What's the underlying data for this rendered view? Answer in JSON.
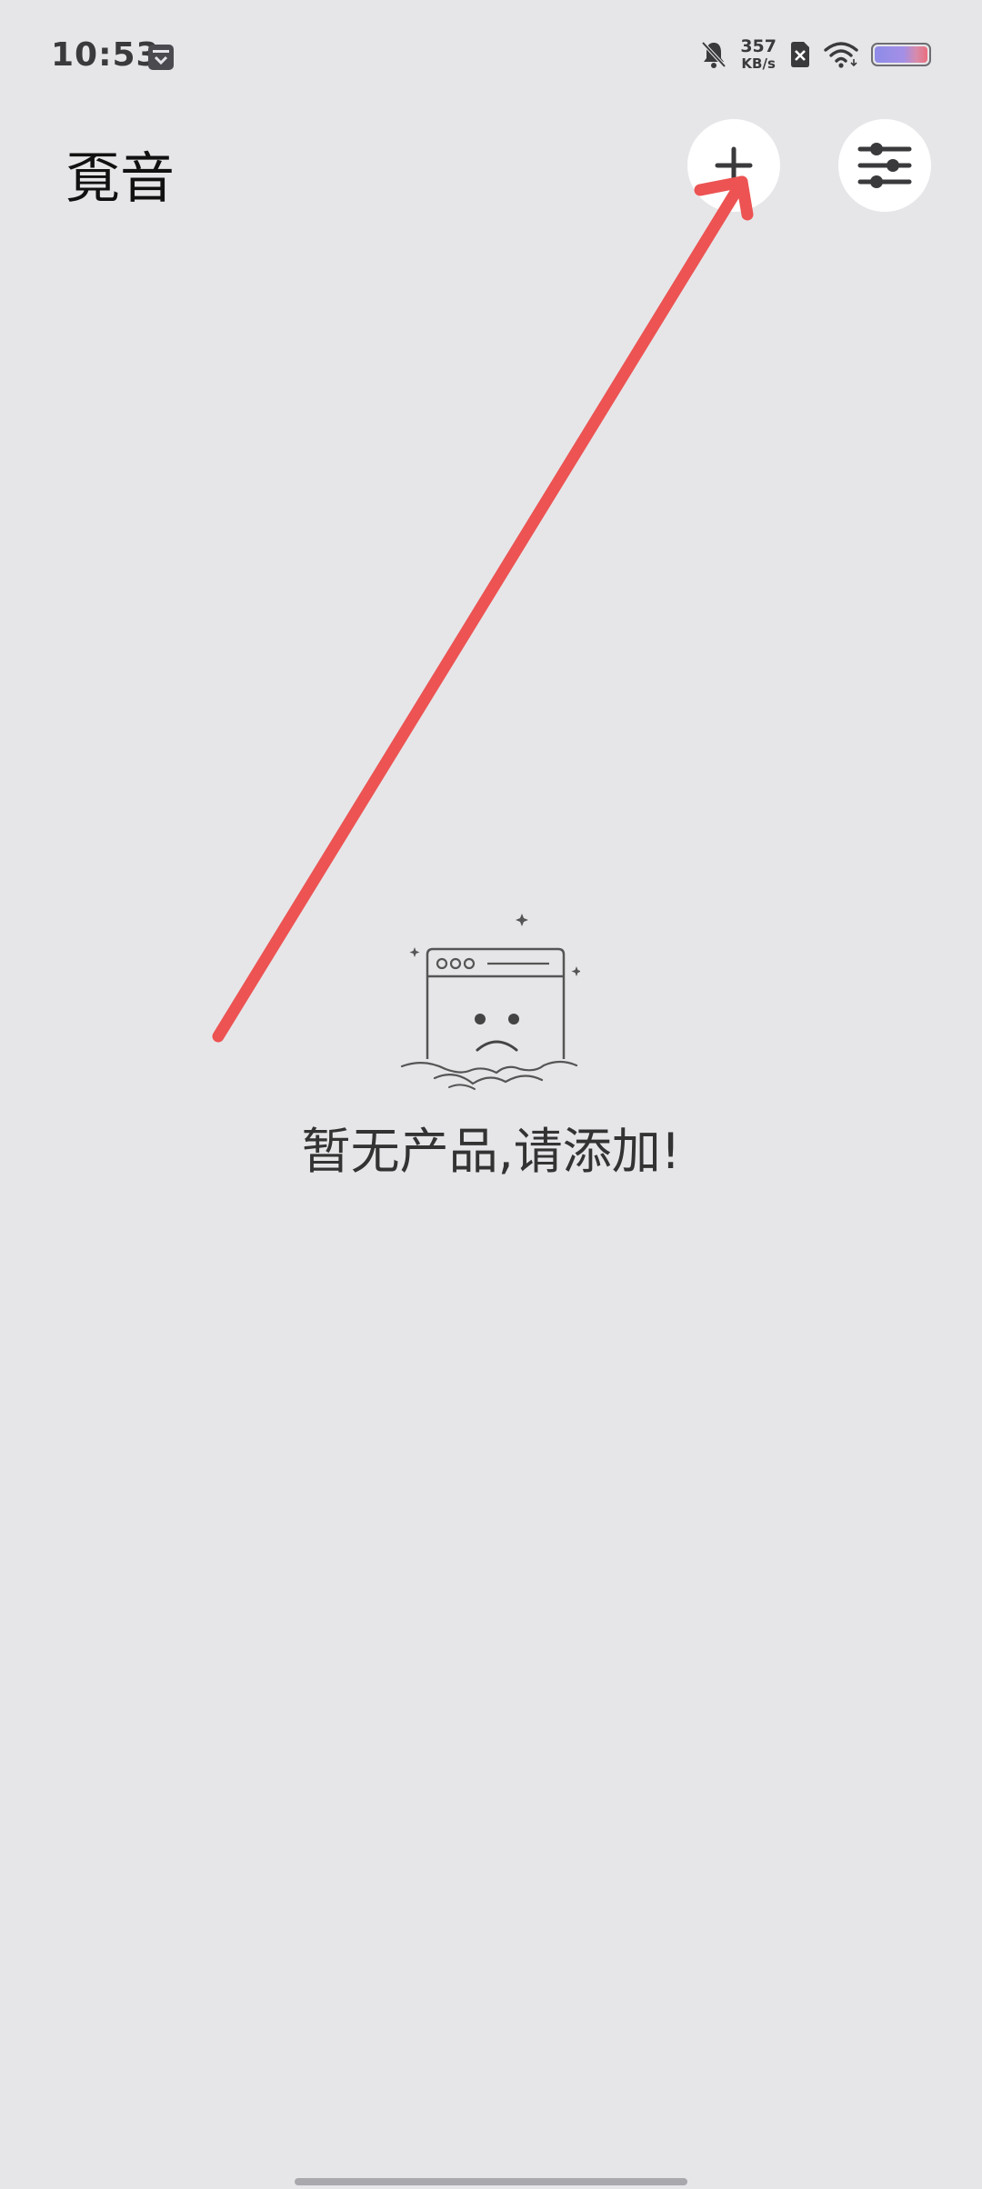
{
  "status_bar": {
    "time": "10:53",
    "net_speed_value": "357",
    "net_speed_unit": "KB/s",
    "icons": [
      "calendar-icon",
      "bell-muted-icon",
      "sim-disabled-icon",
      "wifi-icon",
      "battery-icon"
    ]
  },
  "header": {
    "title": "覔音",
    "add_icon": "plus-icon",
    "settings_icon": "sliders-icon"
  },
  "empty_state": {
    "illustration": "sad-browser-window",
    "message": "暂无产品,请添加!"
  },
  "colors": {
    "background": "#e6e6e9",
    "annotation_arrow": "#ec5352",
    "button_bg": "#ffffff",
    "icon_dark": "#3a3a3c"
  }
}
